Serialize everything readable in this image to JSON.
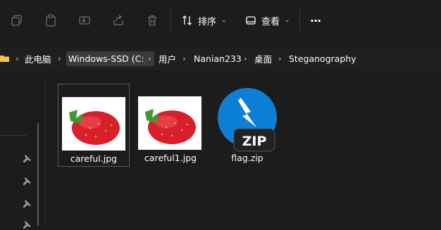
{
  "toolbar": {
    "sort_label": "排序",
    "view_label": "查看",
    "more_label": "···"
  },
  "breadcrumb": {
    "items": [
      "此电脑",
      "Windows-SSD (C:)",
      "用户",
      "Nanian233",
      "桌面",
      "Steganography"
    ]
  },
  "files": [
    {
      "name": "careful.jpg",
      "type": "image"
    },
    {
      "name": "careful1.jpg",
      "type": "image"
    },
    {
      "name": "flag.zip",
      "type": "zip",
      "badge": "ZIP"
    }
  ],
  "colors": {
    "background": "#1c1c1c",
    "zip_blue": "#0e7fd6",
    "strawberry": "#d8202c"
  }
}
